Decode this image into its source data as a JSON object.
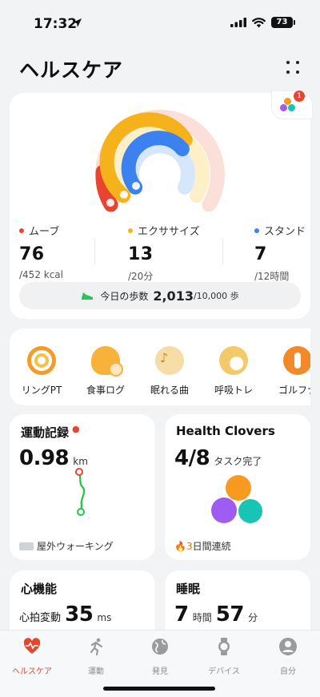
{
  "status_bar": {
    "time": "17:32",
    "battery": "73"
  },
  "header": {
    "title": "ヘルスケア"
  },
  "rings_card": {
    "badge_count": "1",
    "move": {
      "label": "ムーブ",
      "value": "76",
      "goal": "/452 kcal",
      "color": "#e8442f"
    },
    "exercise": {
      "label": "エクササイズ",
      "value": "13",
      "goal": "/20分",
      "color": "#f6b21b"
    },
    "stand": {
      "label": "スタンド",
      "value": "7",
      "goal": "/12時間",
      "color": "#3b82f0"
    },
    "steps": {
      "prefix": "今日の歩数",
      "count": "2,013",
      "goal": "/10,000 歩"
    }
  },
  "shortcuts": [
    {
      "label": "リングPT",
      "icon": "rings-icon"
    },
    {
      "label": "食事ログ",
      "icon": "meal-icon"
    },
    {
      "label": "眠れる曲",
      "icon": "music-moon-icon"
    },
    {
      "label": "呼吸トレ",
      "icon": "breath-icon"
    },
    {
      "label": "ゴルフナ",
      "icon": "golf-icon"
    }
  ],
  "exercise_card": {
    "title": "運動記録",
    "distance": "0.98",
    "unit": "km",
    "activity": "屋外ウォーキング"
  },
  "clovers_card": {
    "title": "Health Clovers",
    "done": "4/8",
    "suffix": "タスク完了",
    "streak": "3",
    "streak_suffix": "日間連続"
  },
  "heart_card": {
    "title": "心機能",
    "label": "心拍変動",
    "value": "35",
    "unit": "ms"
  },
  "sleep_card": {
    "title": "睡眠",
    "hours": "7",
    "hours_unit": "時間",
    "minutes": "57",
    "minutes_unit": "分"
  },
  "tabs": [
    {
      "label": "ヘルスケア",
      "active": true
    },
    {
      "label": "運動",
      "active": false
    },
    {
      "label": "発見",
      "active": false
    },
    {
      "label": "デバイス",
      "active": false
    },
    {
      "label": "自分",
      "active": false
    }
  ]
}
